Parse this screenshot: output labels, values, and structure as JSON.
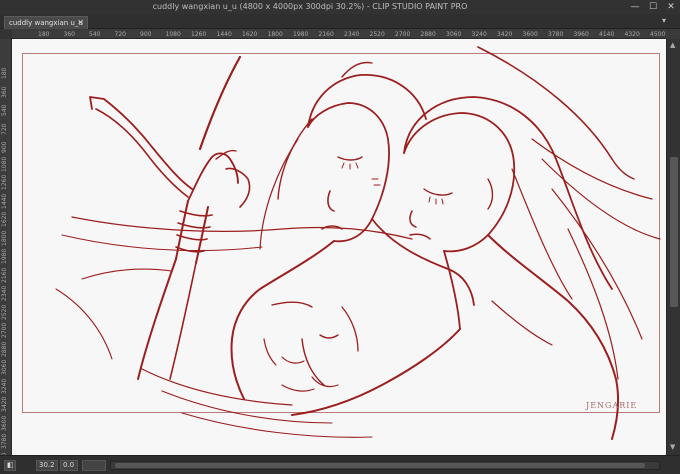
{
  "window": {
    "title": "cuddly wangxian u_u (4800 x 4000px 300dpi 30.2%) - CLIP STUDIO PAINT PRO",
    "minimize_glyph": "—",
    "maximize_glyph": "☐",
    "close_glyph": "✕"
  },
  "tab": {
    "label": "cuddly wangxian u_u",
    "close_glyph": "✕",
    "overflow_glyph": "▾"
  },
  "ruler_h": [
    "180",
    "360",
    "540",
    "720",
    "900",
    "1080",
    "1260",
    "1440",
    "1620",
    "1800",
    "1980",
    "2160",
    "2340",
    "2520",
    "2700",
    "2880",
    "3060",
    "3240",
    "3420",
    "3600",
    "3780",
    "3960",
    "4140",
    "4320",
    "4500"
  ],
  "ruler_v": [
    "180",
    "360",
    "540",
    "720",
    "900",
    "1080",
    "1260",
    "1440",
    "1620",
    "1800",
    "1980",
    "2160",
    "2340",
    "2520",
    "2700",
    "2880",
    "3060",
    "3240",
    "3420",
    "3600",
    "3780",
    "3960"
  ],
  "artwork": {
    "signature": "JENGARIE",
    "line_color": "#9b1f1f"
  },
  "statusbar": {
    "zoom": "30.2",
    "angle": "0.0"
  },
  "colors": {
    "chrome": "#3a3a3a",
    "canvas": "#f7f7f7",
    "frame": "#b97c7c"
  }
}
